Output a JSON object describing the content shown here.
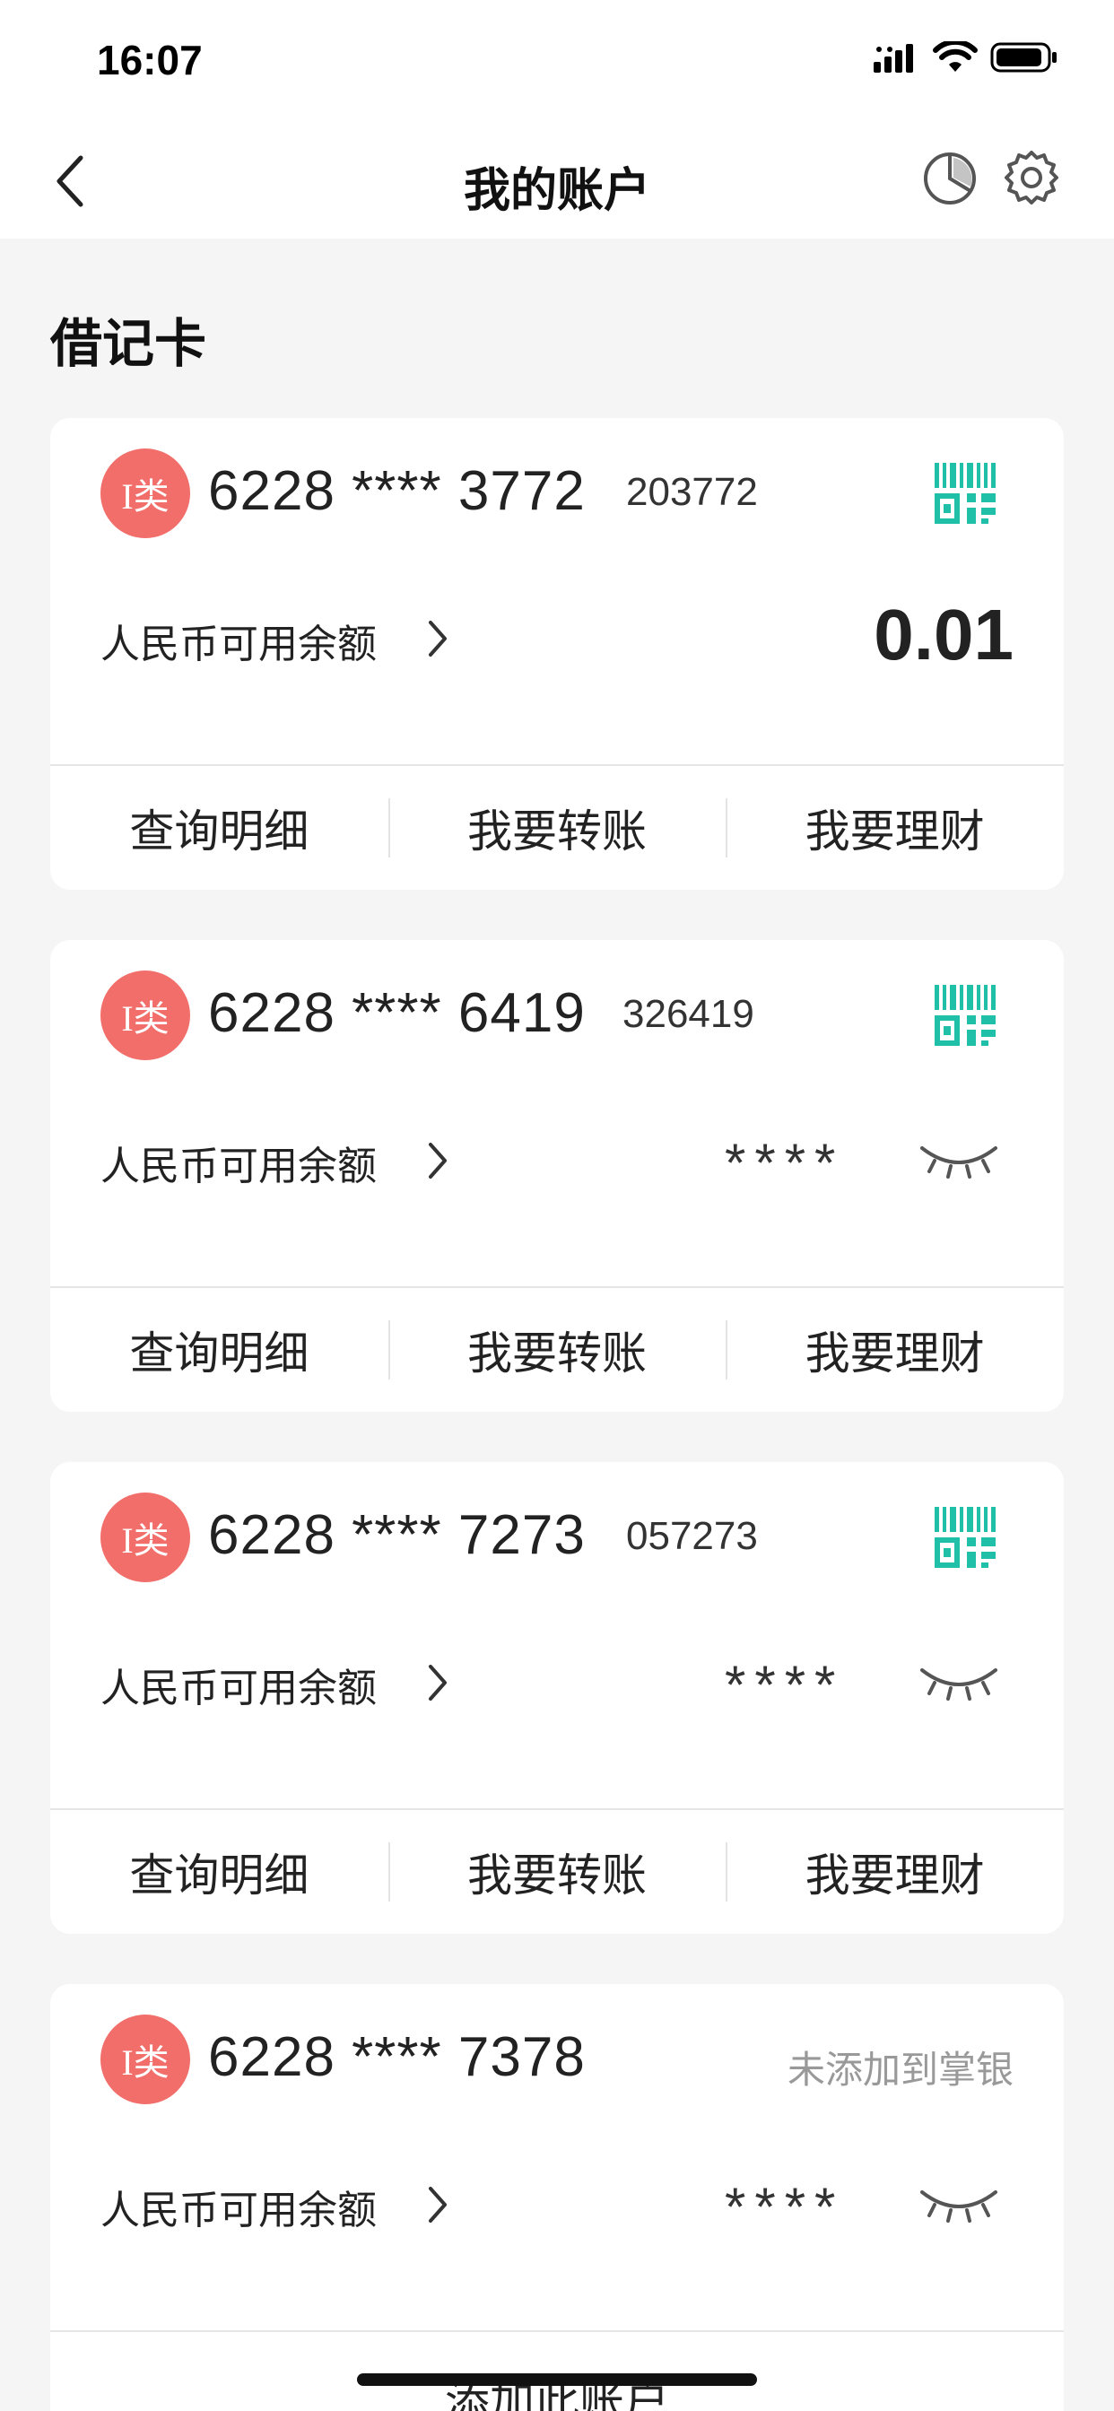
{
  "status_bar": {
    "time": "16:07"
  },
  "nav": {
    "title": "我的账户",
    "back_icon": "chevron-left-icon",
    "chart_icon": "pie-chart-icon",
    "settings_icon": "gear-icon"
  },
  "section": {
    "title": "借记卡"
  },
  "colors": {
    "badge": "#f26e6a",
    "qr": "#1fbfa8",
    "background": "#f5f5f5"
  },
  "cards": [
    {
      "badge": "I类",
      "number": "6228 **** 3772",
      "tail": "203772",
      "balance_label": "人民币可用余额",
      "balance": "0.01",
      "actions": [
        "查询明细",
        "我要转账",
        "我要理财"
      ]
    },
    {
      "badge": "I类",
      "number": "6228 **** 6419",
      "tail": "326419",
      "balance_label": "人民币可用余额",
      "balance_mask": "****",
      "actions": [
        "查询明细",
        "我要转账",
        "我要理财"
      ]
    },
    {
      "badge": "I类",
      "number": "6228 **** 7273",
      "tail": "057273",
      "balance_label": "人民币可用余额",
      "balance_mask": "****",
      "actions": [
        "查询明细",
        "我要转账",
        "我要理财"
      ]
    },
    {
      "badge": "I类",
      "number": "6228 **** 7378",
      "status": "未添加到掌银",
      "balance_label": "人民币可用余额",
      "balance_mask": "****",
      "add_label": "添加此账户"
    }
  ]
}
